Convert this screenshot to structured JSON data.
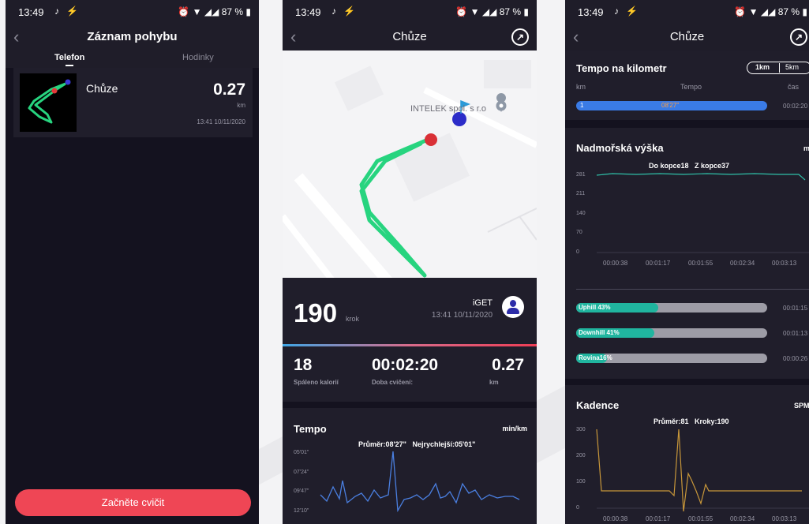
{
  "status_bar": {
    "time": "13:49",
    "battery": "87 %"
  },
  "screen1": {
    "title": "Záznam pohybu",
    "tabs": [
      "Telefon",
      "Hodinky"
    ],
    "record": {
      "activity": "Chůze",
      "distance": "0.27",
      "unit": "km",
      "datetime": "13:41 10/11/2020"
    },
    "start_button": "Začněte cvičit"
  },
  "screen2": {
    "title": "Chůze",
    "map": {
      "place_label": "INTELEK spol. s r.o"
    },
    "steps": {
      "value": "190",
      "unit": "krok"
    },
    "device": {
      "name": "iGET",
      "datetime": "13:41 10/11/2020"
    },
    "stats": [
      {
        "value": "18",
        "label": "Spáleno kalorií"
      },
      {
        "value": "00:02:20",
        "label": "Doba cvičení:"
      },
      {
        "value": "0.27",
        "label": "km"
      }
    ],
    "pace": {
      "title": "Tempo",
      "unit": "min/km",
      "summary": "Průměr:08'27\"   Nejrychlejší:05'01\"",
      "y_labels": [
        "05'01\"",
        "07'24\"",
        "09'47\"",
        "12'10\""
      ]
    }
  },
  "screen3": {
    "title": "Chůze",
    "pace_km": {
      "title": "Tempo na kilometr",
      "toggle": [
        "1km",
        "5km"
      ],
      "columns": [
        "km",
        "Tempo",
        "čas"
      ],
      "row": {
        "km": "1",
        "pace": "08'27\"",
        "time": "00:02:20",
        "fill": 1.0
      }
    },
    "altitude": {
      "title": "Nadmořská výška",
      "unit": "m",
      "summary": "Do kopce18   Z kopce37",
      "y_labels": [
        "281",
        "211",
        "140",
        "70",
        "0"
      ],
      "x_labels": [
        "00:00:38",
        "00:01:17",
        "00:01:55",
        "00:02:34",
        "00:03:13"
      ],
      "bars": [
        {
          "label": "Uphill 43%",
          "fraction": 0.43,
          "time": "00:01:15"
        },
        {
          "label": "Downhill 41%",
          "fraction": 0.41,
          "time": "00:01:13"
        },
        {
          "label": "Rovina16%",
          "fraction": 0.16,
          "time": "00:00:26"
        }
      ]
    },
    "cadence": {
      "title": "Kadence",
      "unit": "SPM",
      "summary": "Průměr:81   Kroky:190",
      "y_labels": [
        "300",
        "200",
        "100",
        "0"
      ],
      "x_labels": [
        "00:00:38",
        "00:01:17",
        "00:01:55",
        "00:02:34",
        "00:03:13"
      ]
    }
  }
}
